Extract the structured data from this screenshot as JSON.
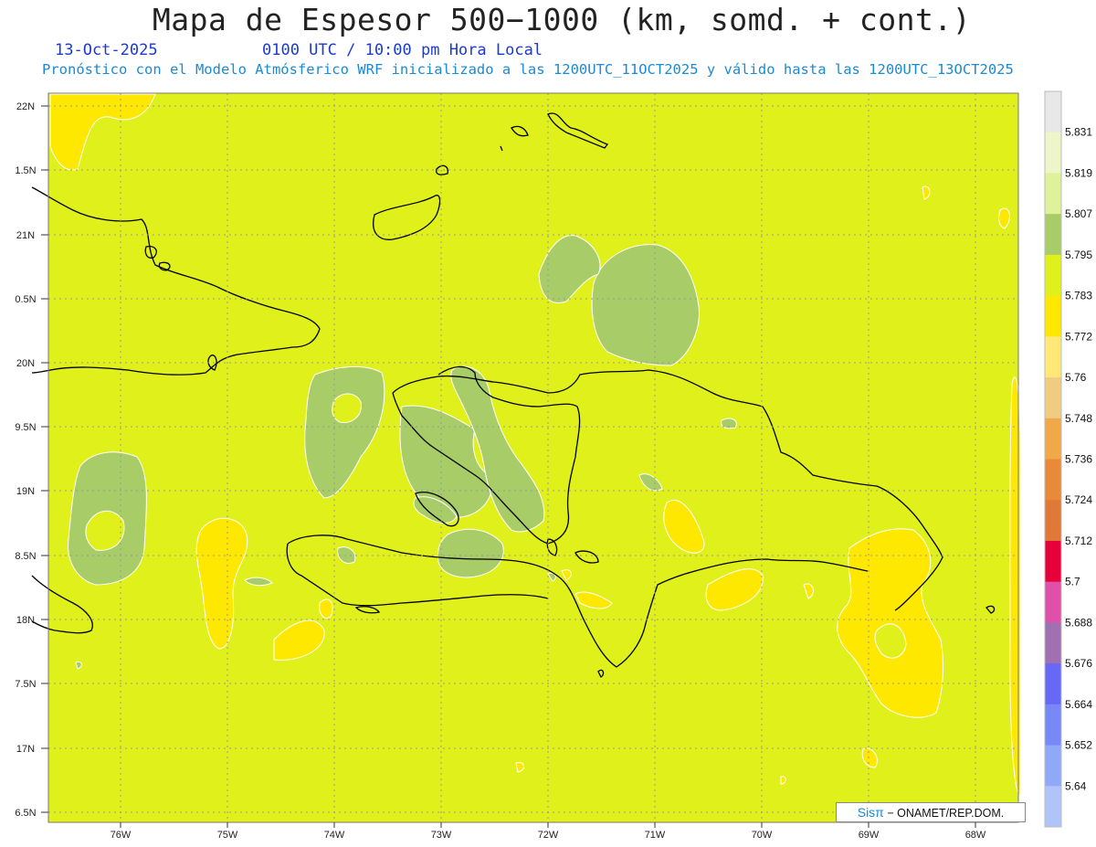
{
  "header": {
    "title": "Mapa de Espesor 500−1000 (km, somd. + cont.)",
    "date": "13-Oct-2025",
    "time": "0100 UTC / 10:00 pm Hora Local",
    "description": "Pronóstico con el Modelo Atmósferico WRF inicializado a las 1200UTC_11OCT2025 y válido hasta las  1200UTC_13OCT2025"
  },
  "axes": {
    "lat_labels": [
      "22N",
      "1.5N",
      "21N",
      "0.5N",
      "20N",
      "9.5N",
      "19N",
      "8.5N",
      "18N",
      "7.5N",
      "17N",
      "6.5N"
    ],
    "lon_labels": [
      "76W",
      "75W",
      "74W",
      "73W",
      "72W",
      "71W",
      "70W",
      "69W",
      "68W"
    ]
  },
  "colorbar": {
    "labels": [
      "5.831",
      "5.819",
      "5.807",
      "5.795",
      "5.783",
      "5.772",
      "5.76",
      "5.748",
      "5.736",
      "5.724",
      "5.712",
      "5.7",
      "5.688",
      "5.676",
      "5.664",
      "5.652",
      "5.64"
    ],
    "colors": [
      "#e8e8e8",
      "#eef5c8",
      "#ddf29a",
      "#a8cc68",
      "#e0f01a",
      "#ffe800",
      "#ffe878",
      "#f0cc80",
      "#f0a848",
      "#e88a38",
      "#e07838",
      "#e8003a",
      "#e050a8",
      "#a070b0",
      "#6868f8",
      "#7888f8",
      "#90a8f8",
      "#b0c4fa"
    ]
  },
  "colors": {
    "background_field": "#e0f01a",
    "higher_field": "#a8cc68",
    "lower_field": "#ffe800",
    "coastline": "#000000"
  },
  "credit": {
    "brand": "Sisπ",
    "text": "− ONAMET/REP.DOM."
  }
}
